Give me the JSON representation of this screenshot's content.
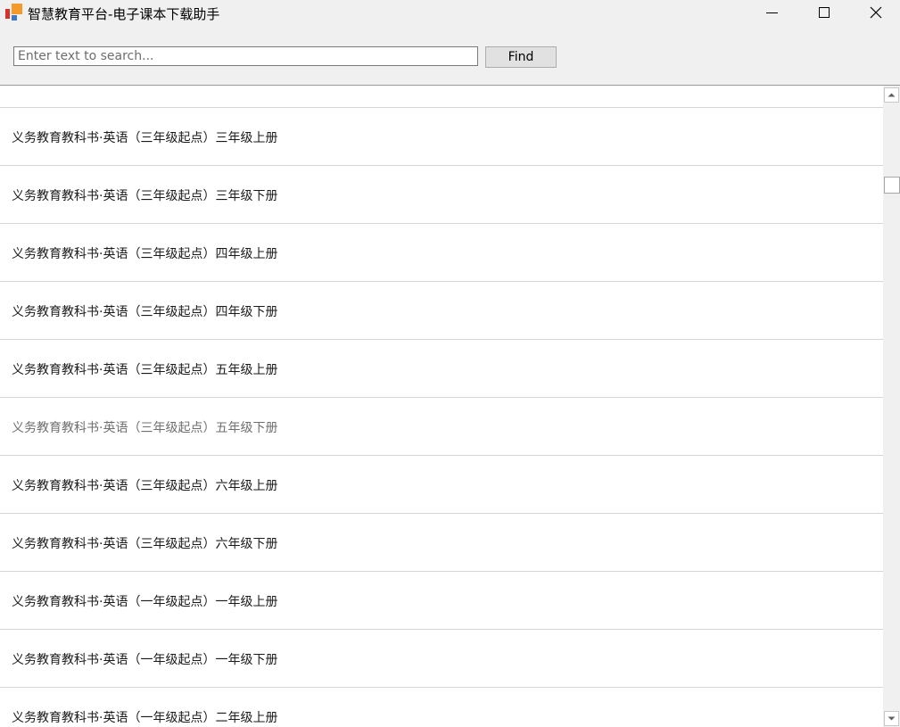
{
  "window": {
    "title": "智慧教育平台-电子课本下载助手"
  },
  "search": {
    "placeholder": "Enter text to search...",
    "value": "",
    "find_label": "Find"
  },
  "list": {
    "items": [
      "义务教育教科书·英语（三年级起点）三年级上册",
      "义务教育教科书·英语（三年级起点）三年级下册",
      "义务教育教科书·英语（三年级起点）四年级上册",
      "义务教育教科书·英语（三年级起点）四年级下册",
      "义务教育教科书·英语（三年级起点）五年级上册",
      "义务教育教科书·英语（三年级起点）五年级下册",
      "义务教育教科书·英语（三年级起点）六年级上册",
      "义务教育教科书·英语（三年级起点）六年级下册",
      "义务教育教科书·英语（一年级起点）一年级上册",
      "义务教育教科书·英语（一年级起点）一年级下册",
      "义务教育教科书·英语（一年级起点）二年级上册"
    ]
  },
  "icons": {
    "app": "app-logo-icon",
    "minimize": "minimize-icon",
    "maximize": "maximize-icon",
    "close": "close-icon",
    "scroll_up": "scroll-up-arrow-icon",
    "scroll_down": "scroll-down-arrow-icon"
  },
  "colors": {
    "logo_red": "#d8312b",
    "logo_orange": "#f39a2b",
    "logo_blue": "#3a78c9"
  }
}
